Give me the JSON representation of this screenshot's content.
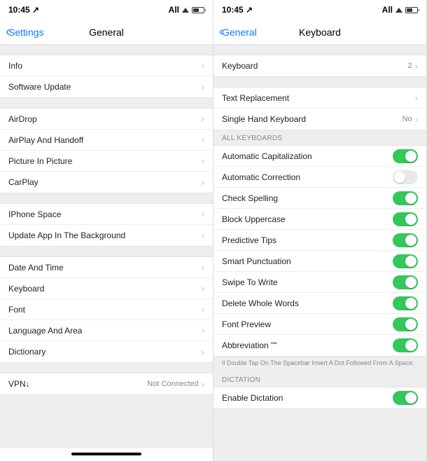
{
  "left": {
    "status": {
      "time": "10:45 ↗",
      "carrier": "All"
    },
    "nav": {
      "back": "Settings",
      "title": "General"
    },
    "groups": [
      [
        {
          "label": "Info"
        },
        {
          "label": "Software Update"
        }
      ],
      [
        {
          "label": "AirDrop"
        },
        {
          "label": "AirPlay And Handoff"
        },
        {
          "label": "Picture In Picture"
        },
        {
          "label": "CarPlay"
        }
      ],
      [
        {
          "label": "IPhone Space"
        },
        {
          "label": "Update App In The Background"
        }
      ],
      [
        {
          "label": "Date And Time"
        },
        {
          "label": "Keyboard"
        },
        {
          "label": "Font"
        },
        {
          "label": "Language And Area"
        },
        {
          "label": "Dictionary"
        }
      ],
      [
        {
          "label": "VPN↓",
          "value": "Not Connected"
        }
      ]
    ]
  },
  "right": {
    "status": {
      "time": "10:45 ↗",
      "carrier": "All"
    },
    "nav": {
      "back": "General",
      "title": "Keyboard"
    },
    "keyboards": {
      "label": "Keyboard",
      "value": "2"
    },
    "settings": [
      {
        "label": "Text Replacement"
      },
      {
        "label": "Single Hand Keyboard",
        "value": "No"
      }
    ],
    "allKeyboardsHeader": "ALL KEYBOARDS",
    "toggles": [
      {
        "label": "Automatic Capitalization",
        "on": true
      },
      {
        "label": "Automatic Correction",
        "on": false
      },
      {
        "label": "Check Spelling",
        "on": true
      },
      {
        "label": "Block Uppercase",
        "on": true
      },
      {
        "label": "Predictive Tips",
        "on": true
      },
      {
        "label": "Smart Punctuation",
        "on": true
      },
      {
        "label": "Swipe To Write",
        "on": true
      },
      {
        "label": "Delete Whole Words",
        "on": true
      },
      {
        "label": "Font Preview",
        "on": true
      },
      {
        "label": "Abbreviation \"\"",
        "on": true
      }
    ],
    "footer": "Il Double Tap On The Spacebar Insert A Dot Followed From A Space.",
    "dictationHeader": "DICTATION",
    "dictation": {
      "label": "Enable Dictation",
      "on": true
    }
  }
}
